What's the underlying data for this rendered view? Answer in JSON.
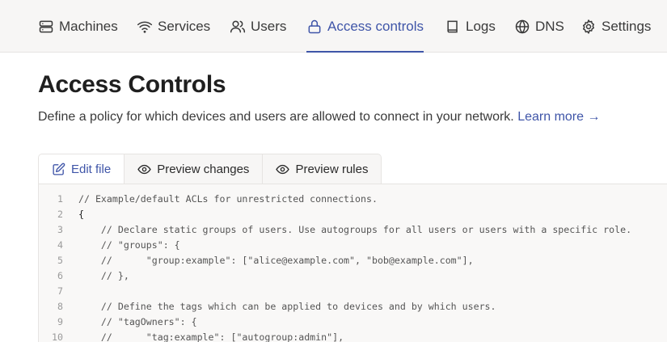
{
  "nav": {
    "items": [
      {
        "label": "Machines",
        "icon": "server-icon"
      },
      {
        "label": "Services",
        "icon": "wifi-icon"
      },
      {
        "label": "Users",
        "icon": "users-icon"
      },
      {
        "label": "Access controls",
        "icon": "lock-icon",
        "active": true
      },
      {
        "label": "Logs",
        "icon": "book-icon"
      },
      {
        "label": "DNS",
        "icon": "globe-icon"
      },
      {
        "label": "Settings",
        "icon": "gear-icon"
      }
    ]
  },
  "page": {
    "title": "Access Controls",
    "subtitle": "Define a policy for which devices and users are allowed to connect in your network.",
    "learn_more": "Learn more →"
  },
  "tabs": [
    {
      "label": "Edit file",
      "icon": "edit-icon",
      "active": true
    },
    {
      "label": "Preview changes",
      "icon": "eye-icon"
    },
    {
      "label": "Preview rules",
      "icon": "eye-icon"
    }
  ],
  "editor": {
    "lines": [
      {
        "n": "1",
        "text": "// Example/default ACLs for unrestricted connections."
      },
      {
        "n": "2",
        "text": "{"
      },
      {
        "n": "3",
        "text": "    // Declare static groups of users. Use autogroups for all users or users with a specific role."
      },
      {
        "n": "4",
        "text": "    // \"groups\": {"
      },
      {
        "n": "5",
        "text": "    //      \"group:example\": [\"alice@example.com\", \"bob@example.com\"],"
      },
      {
        "n": "6",
        "text": "    // },"
      },
      {
        "n": "7",
        "text": ""
      },
      {
        "n": "8",
        "text": "    // Define the tags which can be applied to devices and by which users."
      },
      {
        "n": "9",
        "text": "    // \"tagOwners\": {"
      },
      {
        "n": "10",
        "text": "    //      \"tag:example\": [\"autogroup:admin\"],"
      }
    ]
  },
  "colors": {
    "accent": "#3f55a8",
    "nav_bg": "#f7f6f5",
    "editor_bg": "#f9f8f7"
  }
}
